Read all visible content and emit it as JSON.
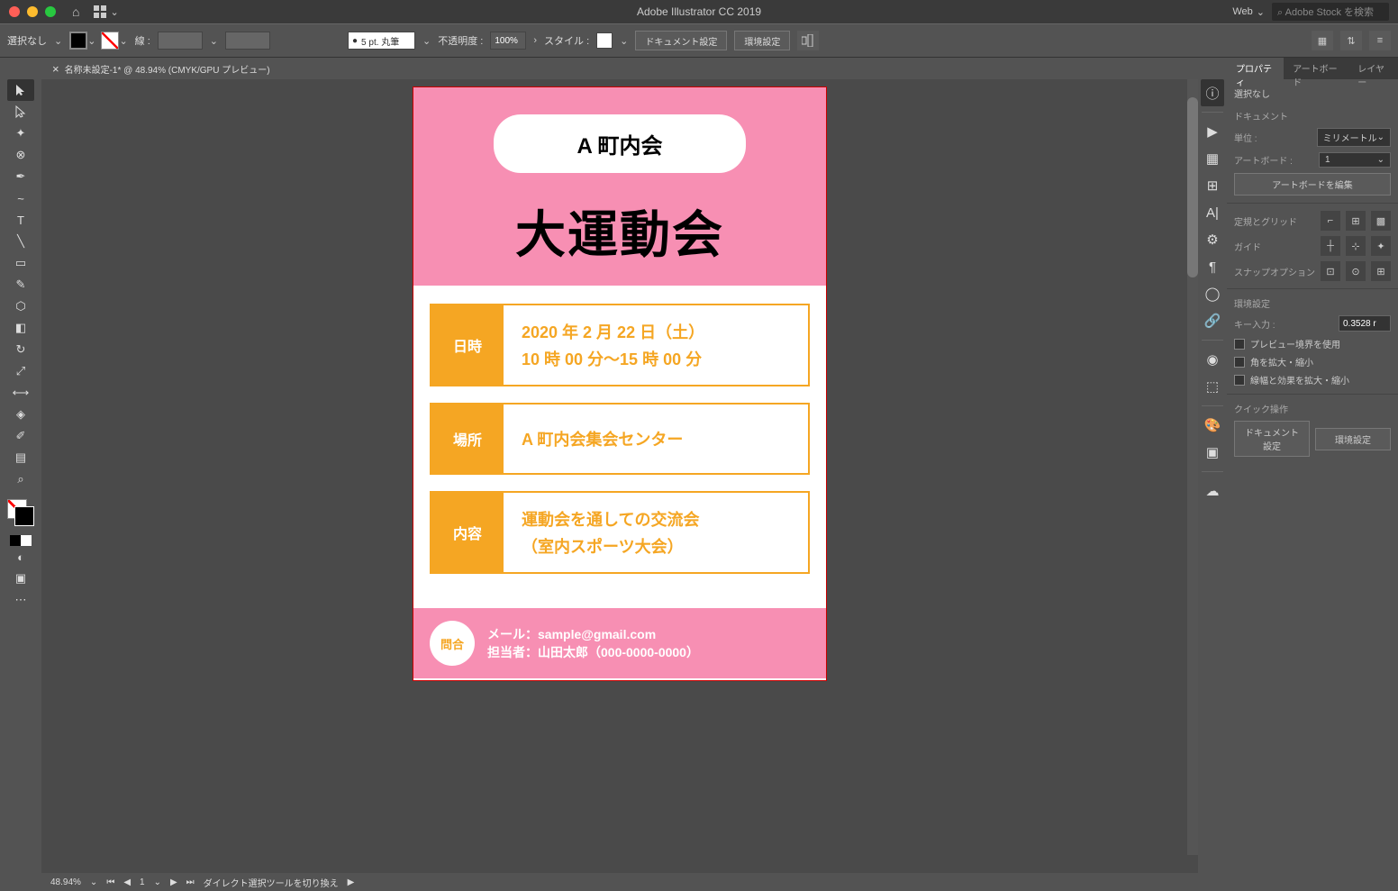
{
  "titlebar": {
    "title": "Adobe Illustrator CC 2019",
    "web": "Web",
    "stock_placeholder": "Adobe Stock を検索"
  },
  "controlbar": {
    "selection": "選択なし",
    "stroke_label": "線 :",
    "brush": "5 pt. 丸筆",
    "opacity_label": "不透明度 :",
    "opacity_value": "100%",
    "style_label": "スタイル :",
    "doc_settings": "ドキュメント設定",
    "prefs": "環境設定"
  },
  "doc_tab": {
    "close": "×",
    "name": "名称未設定-1* @ 48.94% (CMYK/GPU プレビュー)"
  },
  "poster": {
    "pill": "A 町内会",
    "title": "大運動会",
    "rows": [
      {
        "label": "日時",
        "line1": "2020 年 2 月 22 日（土）",
        "line2": "10 時 00 分～15 時 00 分"
      },
      {
        "label": "場所",
        "line1": "A 町内会集会センター",
        "line2": ""
      },
      {
        "label": "内容",
        "line1": "運動会を通しての交流会",
        "line2": "（室内スポーツ大会）"
      }
    ],
    "contact_circle": "問合",
    "contact_line1": "メール：sample@gmail.com",
    "contact_line2": "担当者：山田太郎（000-0000-0000）"
  },
  "status": {
    "zoom": "48.94%",
    "artboard": "1",
    "info": "ダイレクト選択ツールを切り換え"
  },
  "rpanel": {
    "tabs": {
      "prop": "プロパティ",
      "artboard": "アートボード",
      "layers": "レイヤー"
    },
    "no_sel": "選択なし",
    "doc_title": "ドキュメント",
    "units_label": "単位 :",
    "units_value": "ミリメートル",
    "artboard_label": "アートボード :",
    "artboard_value": "1",
    "edit_artboards": "アートボードを編集",
    "ruler_grid": "定規とグリッド",
    "guides": "ガイド",
    "snap_options": "スナップオプション",
    "prefs": "環境設定",
    "key_input": "キー入力 :",
    "key_value": "0.3528 r",
    "preview_bounds": "プレビュー境界を使用",
    "scale_corners": "角を拡大・縮小",
    "scale_strokes": "線幅と効果を拡大・縮小",
    "quick_actions": "クイック操作",
    "doc_setup_btn": "ドキュメント設定",
    "prefs_btn": "環境設定"
  }
}
